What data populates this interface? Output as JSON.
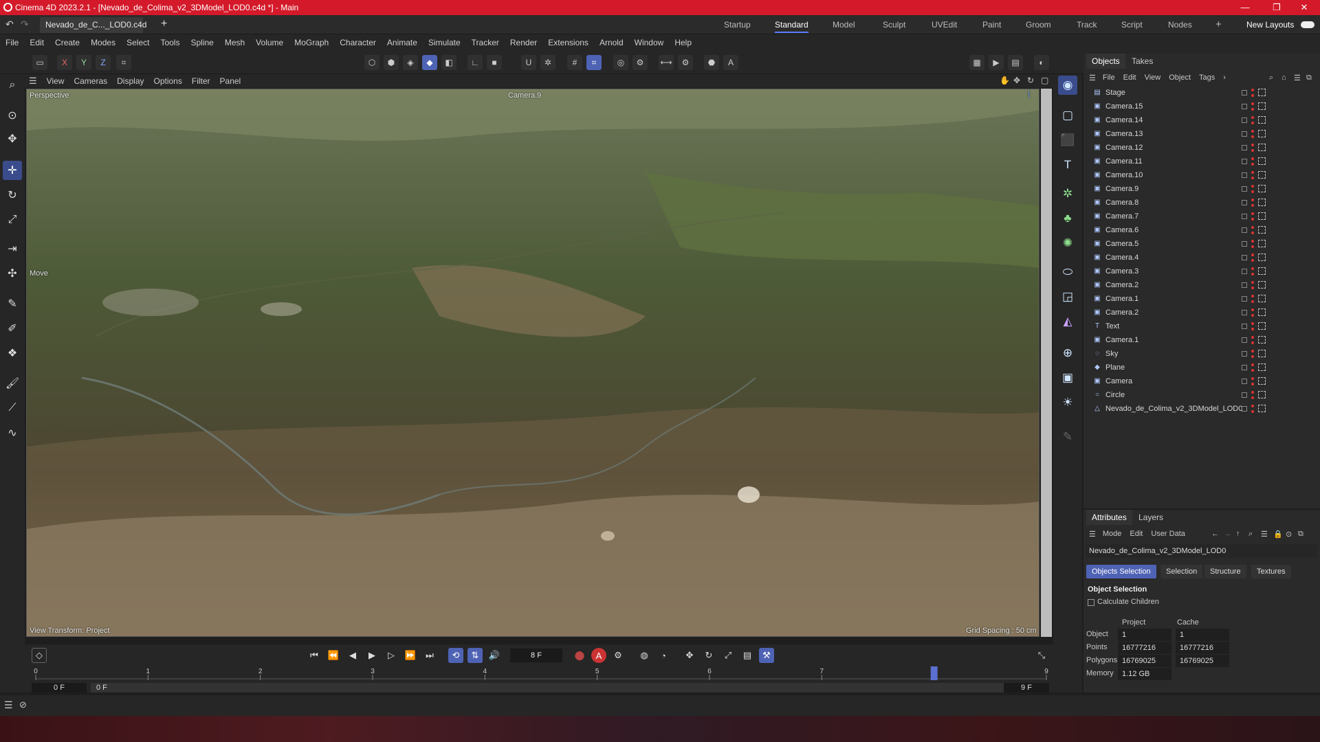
{
  "window": {
    "title": "Cinema 4D 2023.2.1 - [Nevado_de_Colima_v2_3DModel_LOD0.c4d *] - Main"
  },
  "tabs": {
    "doc": "Nevado_de_C..._LOD0.c4d *",
    "plus": "+"
  },
  "layouts": {
    "items": [
      "Startup",
      "Standard",
      "Model",
      "Sculpt",
      "UVEdit",
      "Paint",
      "Groom",
      "Track",
      "Script",
      "Nodes"
    ],
    "active": "Standard",
    "new_layouts": "New Layouts"
  },
  "menu": [
    "File",
    "Edit",
    "Create",
    "Modes",
    "Select",
    "Tools",
    "Spline",
    "Mesh",
    "Volume",
    "MoGraph",
    "Character",
    "Animate",
    "Simulate",
    "Tracker",
    "Render",
    "Extensions",
    "Arnold",
    "Window",
    "Help"
  ],
  "axis": {
    "x": "X",
    "y": "Y",
    "z": "Z"
  },
  "viewport": {
    "menu": [
      "View",
      "Cameras",
      "Display",
      "Options",
      "Filter",
      "Panel"
    ],
    "name": "Perspective",
    "camera": "Camera.9",
    "tool": "Move",
    "view_transform": "View Transform: Project",
    "grid_spacing": "Grid Spacing : 50 cm"
  },
  "objects_panel": {
    "tabs": [
      "Objects",
      "Takes"
    ],
    "menu": [
      "File",
      "Edit",
      "View",
      "Object",
      "Tags"
    ],
    "items": [
      {
        "name": "Stage",
        "icon": "stage-icon"
      },
      {
        "name": "Camera.15",
        "icon": "camera-icon"
      },
      {
        "name": "Camera.14",
        "icon": "camera-icon"
      },
      {
        "name": "Camera.13",
        "icon": "camera-icon"
      },
      {
        "name": "Camera.12",
        "icon": "camera-icon"
      },
      {
        "name": "Camera.11",
        "icon": "camera-icon"
      },
      {
        "name": "Camera.10",
        "icon": "camera-icon"
      },
      {
        "name": "Camera.9",
        "icon": "camera-icon"
      },
      {
        "name": "Camera.8",
        "icon": "camera-icon"
      },
      {
        "name": "Camera.7",
        "icon": "camera-icon"
      },
      {
        "name": "Camera.6",
        "icon": "camera-icon"
      },
      {
        "name": "Camera.5",
        "icon": "camera-icon"
      },
      {
        "name": "Camera.4",
        "icon": "camera-icon"
      },
      {
        "name": "Camera.3",
        "icon": "camera-icon"
      },
      {
        "name": "Camera.2",
        "icon": "camera-icon"
      },
      {
        "name": "Camera.1",
        "icon": "camera-icon"
      },
      {
        "name": "Camera.2",
        "icon": "camera-icon"
      },
      {
        "name": "Text",
        "icon": "text-icon"
      },
      {
        "name": "Camera.1",
        "icon": "camera-icon"
      },
      {
        "name": "Sky",
        "icon": "sky-icon"
      },
      {
        "name": "Plane",
        "icon": "plane-icon"
      },
      {
        "name": "Camera",
        "icon": "camera-icon"
      },
      {
        "name": "Circle",
        "icon": "circle-icon"
      },
      {
        "name": "Nevado_de_Colima_v2_3DModel_LOD0",
        "icon": "polygon-object-icon"
      }
    ]
  },
  "attributes": {
    "tabs": [
      "Attributes",
      "Layers"
    ],
    "menu": [
      "Mode",
      "Edit",
      "User Data"
    ],
    "object_name": "Nevado_de_Colima_v2_3DModel_LOD0",
    "subtabs": [
      "Objects Selection",
      "Selection",
      "Structure",
      "Textures"
    ],
    "active_subtab": "Objects Selection",
    "section": "Object Selection",
    "calc_children": "Calculate Children",
    "headers": [
      "Project",
      "Cache"
    ],
    "rows": [
      {
        "label": "Object",
        "project": "1",
        "cache": "1"
      },
      {
        "label": "Points",
        "project": "16777216",
        "cache": "16777216"
      },
      {
        "label": "Polygons",
        "project": "16769025",
        "cache": "16769025"
      },
      {
        "label": "Memory",
        "project": "1.12 GB",
        "cache": ""
      }
    ]
  },
  "timeline": {
    "current_frame": "8 F",
    "ticks": [
      "0",
      "1",
      "2",
      "3",
      "4",
      "5",
      "6",
      "7",
      "8",
      "9"
    ],
    "start": "0 F",
    "range_start": "0 F",
    "range_end": "9 F",
    "end": "9 F",
    "playhead": 8,
    "max": 9
  }
}
